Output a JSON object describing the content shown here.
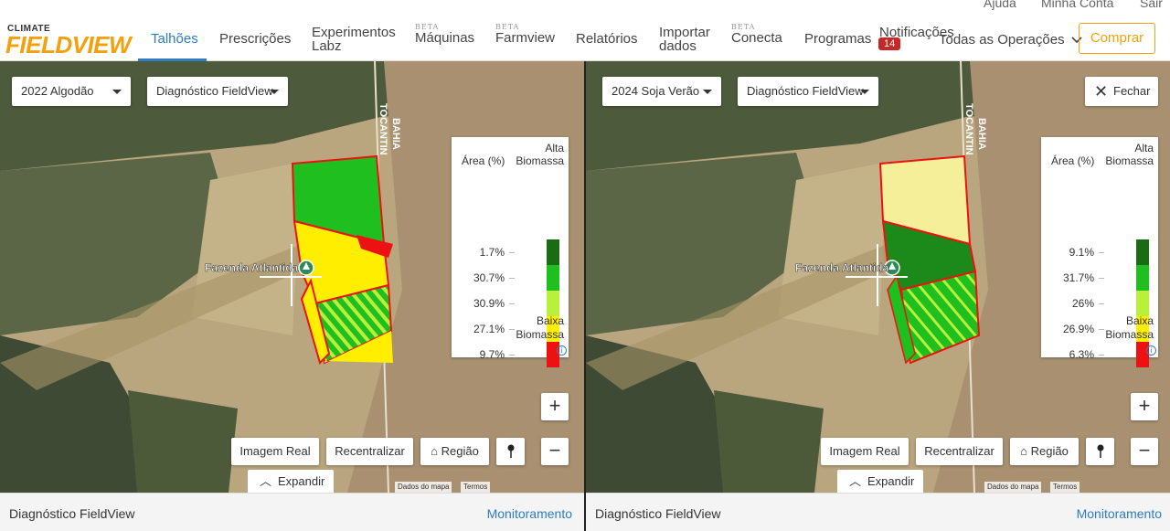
{
  "top_links": [
    "Ajuda",
    "Minha Conta",
    "Sair"
  ],
  "logo": {
    "brand_small": "CLIMATE",
    "brand_main": "FIELDVIEW"
  },
  "nav": [
    {
      "label": "Talhões",
      "beta": "",
      "active": true
    },
    {
      "label": "Prescrições",
      "beta": ""
    },
    {
      "label": "Experimentos Labz",
      "beta": ""
    },
    {
      "label": "Máquinas",
      "beta": "BETA"
    },
    {
      "label": "Farmview",
      "beta": "BETA"
    },
    {
      "label": "Relatórios",
      "beta": ""
    },
    {
      "label": "Importar dados",
      "beta": ""
    },
    {
      "label": "Conecta",
      "beta": "BETA"
    },
    {
      "label": "Programas",
      "beta": ""
    },
    {
      "label": "Notificações",
      "beta": ""
    }
  ],
  "notifications_count": "14",
  "operations_dropdown": "Todas as Operações",
  "buy_button": "Comprar",
  "panels": [
    {
      "season": "2022 Algodão",
      "layer": "Diagnóstico FieldView",
      "close_label": "",
      "legend": {
        "col_header": "Área (%)",
        "high_label_1": "Alta",
        "high_label_2": "Biomassa",
        "low_label_1": "Baixa",
        "low_label_2": "Biomassa",
        "rows": [
          {
            "pct": "1.7%",
            "color": "#1b6b14"
          },
          {
            "pct": "30.7%",
            "color": "#1fbf1f"
          },
          {
            "pct": "30.9%",
            "color": "#b8f03a"
          },
          {
            "pct": "27.1%",
            "color": "#ffee00"
          },
          {
            "pct": "9.7%",
            "color": "#ee1111"
          }
        ]
      },
      "farm_label": "Fazenda Atlantida",
      "road_label": "BAHIA TOCANTINS",
      "buttons": {
        "real": "Imagem Real",
        "recenter": "Recentralizar",
        "region": "Região",
        "expand": "Expandir"
      },
      "attribution": {
        "data": "Dados do mapa",
        "terms": "Termos"
      },
      "footer": {
        "title": "Diagnóstico FieldView",
        "link": "Monitoramento"
      }
    },
    {
      "season": "2024 Soja Verão",
      "layer": "Diagnóstico FieldView",
      "close_label": "Fechar",
      "legend": {
        "col_header": "Área (%)",
        "high_label_1": "Alta",
        "high_label_2": "Biomassa",
        "low_label_1": "Baixa",
        "low_label_2": "Biomassa",
        "rows": [
          {
            "pct": "9.1%",
            "color": "#1b6b14"
          },
          {
            "pct": "31.7%",
            "color": "#1fbf1f"
          },
          {
            "pct": "26%",
            "color": "#b8f03a"
          },
          {
            "pct": "26.9%",
            "color": "#ffee00"
          },
          {
            "pct": "6.3%",
            "color": "#ee1111"
          }
        ]
      },
      "farm_label": "Fazenda Atlantida",
      "road_label": "BAHIA TOCANTINS",
      "buttons": {
        "real": "Imagem Real",
        "recenter": "Recentralizar",
        "region": "Região",
        "expand": "Expandir"
      },
      "attribution": {
        "data": "Dados do mapa",
        "terms": "Termos"
      },
      "footer": {
        "title": "Diagnóstico FieldView",
        "link": "Monitoramento"
      }
    }
  ]
}
